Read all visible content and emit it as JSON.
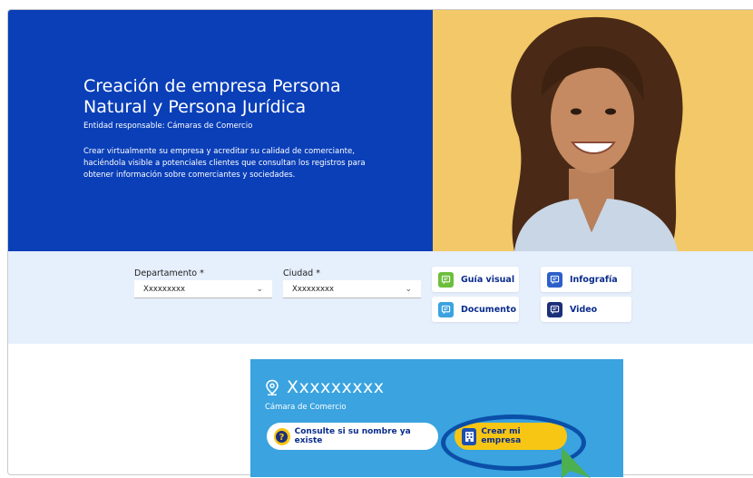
{
  "hero": {
    "title": "Creación de empresa Persona Natural y Persona Jurídica",
    "entity": "Entidad responsable: Cámaras de Comercio",
    "description": "Crear virtualmente su empresa y acreditar su calidad de comerciante, haciéndola visible a potenciales clientes que consultan los registros para obtener información sobre comerciantes y sociedades."
  },
  "filters": {
    "department_label": "Departamento *",
    "department_value": "Xxxxxxxxx",
    "city_label": "Ciudad *",
    "city_value": "Xxxxxxxxx"
  },
  "resources": {
    "visual_guide": "Guía visual",
    "infographic": "Infografía",
    "document": "Documento",
    "video": "Video"
  },
  "result": {
    "location": "Xxxxxxxxx",
    "chamber": "Cámara de Comercio",
    "check_name": "Consulte si su nombre ya existe",
    "create_company": "Crear mi empresa"
  },
  "colors": {
    "hero_blue": "#0a3fb8",
    "band": "#e6effc",
    "card_blue": "#3aa3e0",
    "cta_yellow": "#f7c614",
    "visual_guide_icon": "#6cbf3c",
    "infographic_icon": "#2c5fc9",
    "document_icon": "#3aa3e0",
    "video_icon": "#1c2f7a",
    "highlight": "#0a4fa8",
    "pointer": "#4caf50"
  }
}
